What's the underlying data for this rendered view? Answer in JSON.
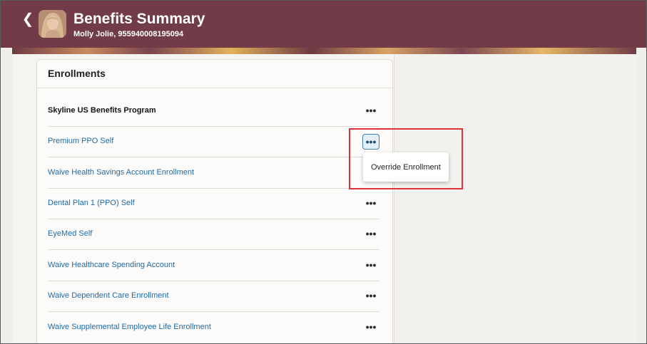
{
  "header": {
    "back_icon": "chevron-left-icon",
    "title": "Benefits Summary",
    "subtitle": "Molly Jolie, 955940008195094",
    "background_color": "#713c47"
  },
  "enrollments": {
    "title": "Enrollments",
    "rows": [
      {
        "label": "Skyline US Benefits Program",
        "type": "program",
        "more_icon": "more-horizontal-icon"
      },
      {
        "label": "Premium PPO Self",
        "type": "plan",
        "more_icon": "more-horizontal-icon"
      },
      {
        "label": "Waive Health Savings Account Enrollment",
        "type": "plan",
        "more_icon": "more-horizontal-icon"
      },
      {
        "label": "Dental Plan 1 (PPO) Self",
        "type": "plan",
        "more_icon": "more-horizontal-icon"
      },
      {
        "label": "EyeMed Self",
        "type": "plan",
        "more_icon": "more-horizontal-icon"
      },
      {
        "label": "Waive Healthcare Spending Account",
        "type": "plan",
        "more_icon": "more-horizontal-icon"
      },
      {
        "label": "Waive Dependent Care Enrollment",
        "type": "plan",
        "more_icon": "more-horizontal-icon"
      },
      {
        "label": "Waive Supplemental Employee Life Enrollment",
        "type": "plan",
        "more_icon": "more-horizontal-icon"
      }
    ],
    "more_glyph": "•••"
  },
  "popup_menu": {
    "items": [
      "Override Enrollment"
    ]
  },
  "colors": {
    "link": "#1f6aa5",
    "highlight_box": "#e0323a"
  }
}
